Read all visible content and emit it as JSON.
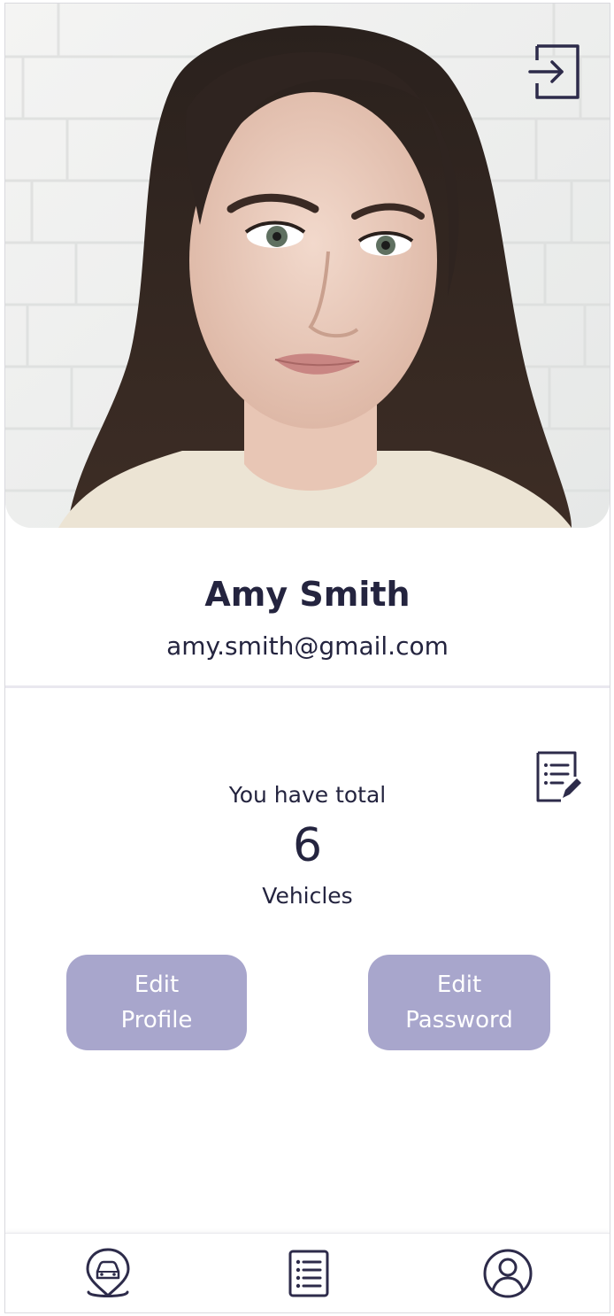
{
  "profile": {
    "name": "Amy Smith",
    "email": "amy.smith@gmail.com"
  },
  "summary": {
    "pre_text": "You have total",
    "vehicle_count": "6",
    "post_text": "Vehicles"
  },
  "buttons": {
    "edit_profile_line1": "Edit",
    "edit_profile_line2": "Profile",
    "edit_password_line1": "Edit",
    "edit_password_line2": "Password"
  },
  "icons": {
    "logout": "logout-icon",
    "list_edit": "list-edit-icon",
    "nav_map": "car-location-icon",
    "nav_list": "list-icon",
    "nav_user": "user-icon"
  },
  "colors": {
    "primary_text": "#24243f",
    "button_bg": "#a8a6cc",
    "button_text": "#ffffff",
    "divider": "#e9e8ef"
  }
}
